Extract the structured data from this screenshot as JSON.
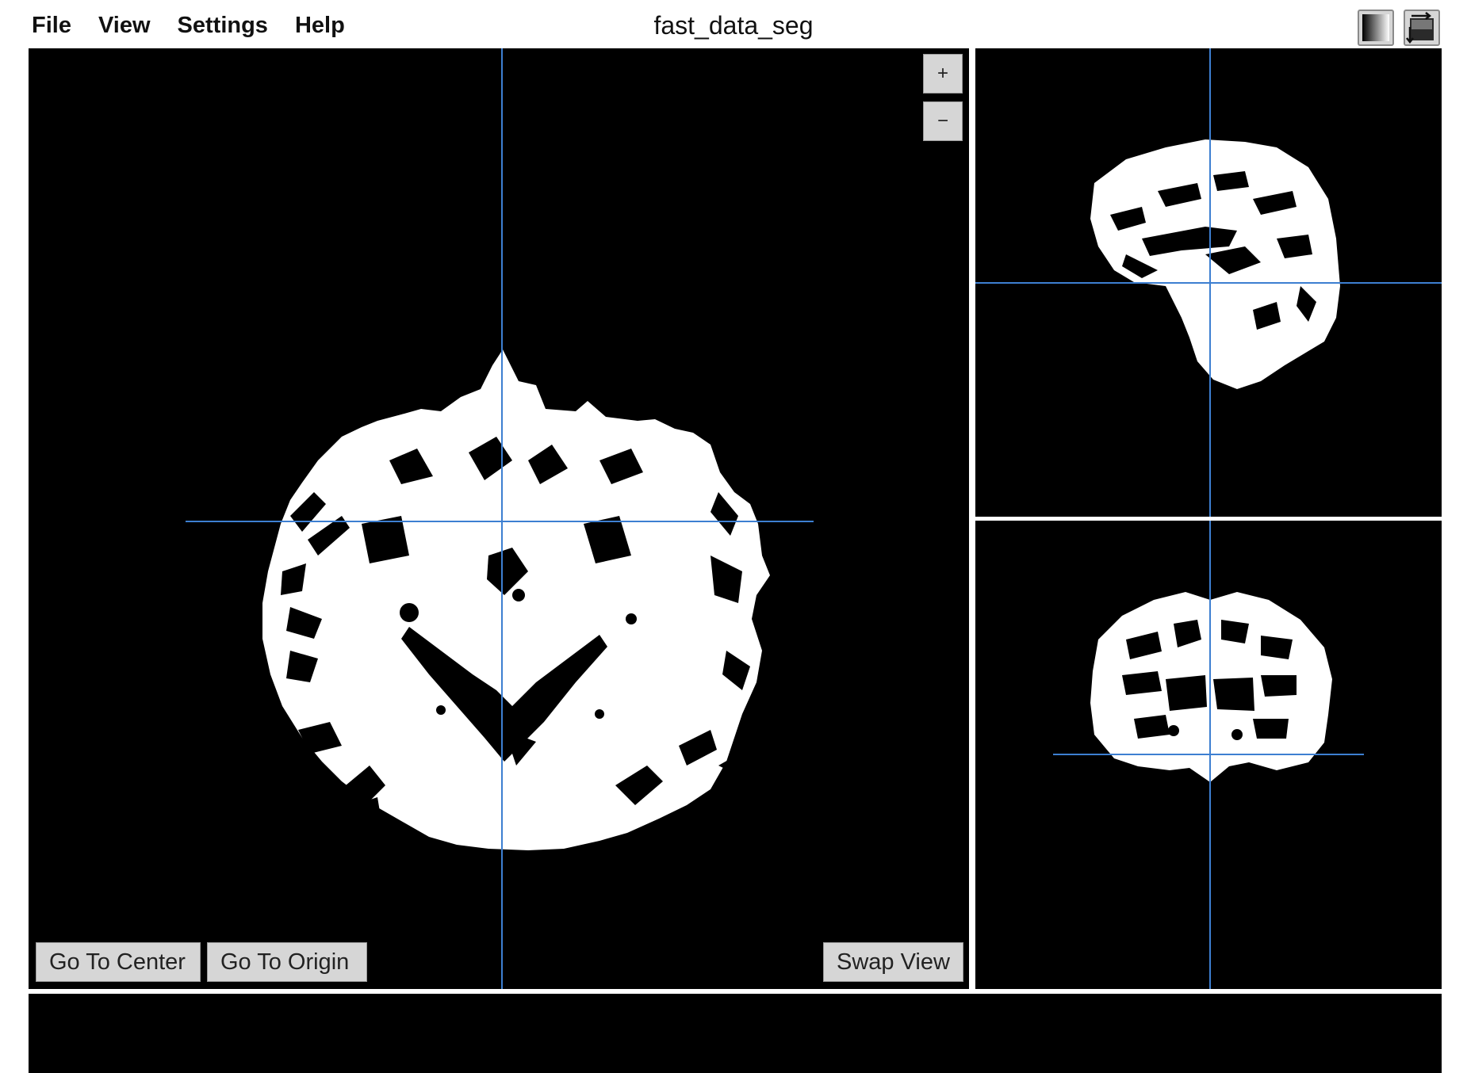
{
  "menu": {
    "items": [
      "File",
      "View",
      "Settings",
      "Help"
    ]
  },
  "app": {
    "title": "fast_data_seg"
  },
  "toolbar": {
    "lut_icon": "grayscale-gradient-icon",
    "swap_icon": "swap-layout-icon"
  },
  "viewer": {
    "zoom_in_label": "+",
    "zoom_out_label": "−",
    "go_to_center_label": "Go To Center",
    "go_to_origin_label": "Go To Origin",
    "swap_view_label": "Swap View"
  },
  "colors": {
    "crosshair": "#3d7fd1",
    "background": "#000000",
    "tissue": "#ffffff"
  }
}
